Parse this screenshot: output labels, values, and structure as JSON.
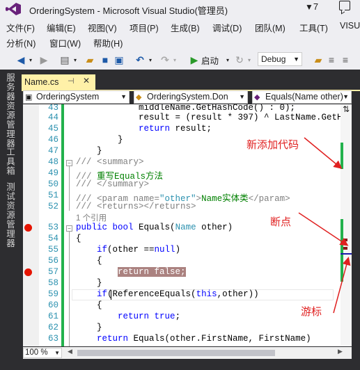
{
  "window": {
    "title": "OrderingSystem - Microsoft Visual Studio(管理员)",
    "notification_count": "7"
  },
  "menu": {
    "row1": [
      "文件(F)",
      "编辑(E)",
      "视图(V)",
      "项目(P)",
      "生成(B)",
      "调试(D)",
      "团队(M)",
      "工具(T)",
      "VISU"
    ],
    "row2": [
      "分析(N)",
      "窗口(W)",
      "帮助(H)"
    ]
  },
  "toolbar": {
    "start_label": "启动",
    "config": "Debug"
  },
  "sidebar": {
    "tabs": [
      "服务器资源管理器",
      "工具箱",
      "测试资源管理器"
    ]
  },
  "tab": {
    "name": "Name.cs"
  },
  "nav": {
    "project": "OrderingSystem",
    "class": "OrderingSystem.Don",
    "member": "Equals(Name other)"
  },
  "code": {
    "line_numbers": [
      "43",
      "44",
      "45",
      "46",
      "47",
      "48",
      "49",
      "50",
      "51",
      "52",
      "53",
      "54",
      "55",
      "56",
      "57",
      "58",
      "59",
      "60",
      "61",
      "62",
      "63"
    ],
    "line43": "            middleName.GetHashCode() : 0);",
    "line44": "            result = (result * 397) ^ LastName.GetH",
    "line45_kw": "return",
    "line45_rest": " result;",
    "line46": "        }",
    "line47": "    }",
    "line48_a": "/// ",
    "line48_b": "<summary>",
    "line49_a": "/// ",
    "line49_b": "重写Equals方法",
    "line50_a": "/// ",
    "line50_b": "</summary>",
    "line51_a": "/// ",
    "line51_b": "<param name=",
    "line51_c": "\"other\"",
    "line51_d": ">",
    "line51_e": "Name实体类",
    "line51_f": "</param>",
    "line52_a": "/// ",
    "line52_b": "<returns></returns>",
    "codelens": "1 个引用",
    "line53_kw1": "public",
    "line53_kw2": "bool",
    "line53_name": " Equals(",
    "line53_type": "Name",
    "line53_rest": " other)",
    "line54": "{",
    "line55_kw": "if",
    "line55_rest": "(other ==",
    "line55_null": "null",
    "line55_end": ")",
    "line56": "{",
    "line57": "return false;",
    "line58": "}",
    "line59_kw": "if",
    "line59_a": "(ReferenceEquals(",
    "line59_this": "this",
    "line59_b": ",other))",
    "line60": "{",
    "line61_kw": "return",
    "line61_true": "true",
    "line61_end": ";",
    "line62": "}",
    "line63_kw": "return",
    "line63_rest": " Equals(other.FirstName, FirstName)"
  },
  "annotations": {
    "new_code": "新添加代码",
    "breakpoint": "断点",
    "cursor": "游标"
  },
  "zoom": "100 %",
  "colors": {
    "accent": "#68217a",
    "changed_line": "#22b14c",
    "breakpoint": "#e51400",
    "annotation": "#e02020",
    "tab_active": "#fff1a8"
  }
}
